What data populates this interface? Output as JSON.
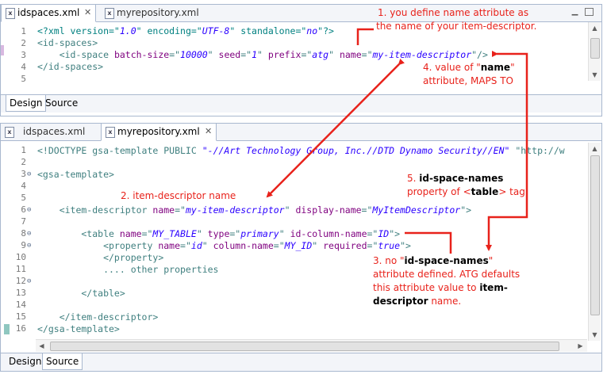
{
  "top_editor": {
    "tabs": [
      {
        "label": "idspaces.xml",
        "icon": "xml-file-icon",
        "active": true,
        "close": "✕"
      },
      {
        "label": "myrepository.xml",
        "icon": "xml-file-icon",
        "active": false
      }
    ],
    "line_numbers": [
      "1",
      "2",
      "3",
      "4",
      "5"
    ],
    "lines": [
      [
        [
          "pi",
          "<?xml version=\""
        ],
        [
          "av",
          "1.0"
        ],
        [
          "pi",
          "\" encoding=\""
        ],
        [
          "av",
          "UTF-8"
        ],
        [
          "pi",
          "\" standalone=\""
        ],
        [
          "av",
          "no"
        ],
        [
          "pi",
          "\"?>"
        ]
      ],
      [
        [
          "tg",
          "<id-spaces>"
        ]
      ],
      [
        [
          "tg",
          "    <id-space "
        ],
        [
          "an",
          "batch-size"
        ],
        [
          "tg",
          "=\""
        ],
        [
          "av",
          "10000"
        ],
        [
          "tg",
          "\" "
        ],
        [
          "an",
          "seed"
        ],
        [
          "tg",
          "=\""
        ],
        [
          "av",
          "1"
        ],
        [
          "tg",
          "\" "
        ],
        [
          "an",
          "prefix"
        ],
        [
          "tg",
          "=\""
        ],
        [
          "av",
          "atg"
        ],
        [
          "tg",
          "\" "
        ],
        [
          "an",
          "name"
        ],
        [
          "tg",
          "=\""
        ],
        [
          "av",
          "my-item-descriptor"
        ],
        [
          "tg",
          "\"/>"
        ]
      ],
      [
        [
          "tg",
          "</id-spaces>"
        ]
      ],
      [
        [
          "tg",
          ""
        ]
      ]
    ],
    "bottom_tabs": [
      "Design",
      "Source"
    ],
    "active_bottom_tab": "Design"
  },
  "bottom_editor": {
    "tabs": [
      {
        "label": "idspaces.xml",
        "icon": "xml-file-icon",
        "active": false
      },
      {
        "label": "myrepository.xml",
        "icon": "xml-file-icon",
        "active": true,
        "close": "✕"
      }
    ],
    "line_numbers": [
      "1",
      "2",
      "3",
      "4",
      "5",
      "6",
      "7",
      "8",
      "9",
      "10",
      "11",
      "12",
      "13",
      "14",
      "15",
      "16"
    ],
    "fold_markers": [
      "",
      "",
      "⊖",
      "",
      "",
      "⊖",
      "",
      "⊖",
      "⊖",
      "",
      "",
      "⊖",
      "",
      "",
      "",
      ""
    ],
    "lines": [
      [
        [
          "tg",
          "<!DOCTYPE gsa-template PUBLIC "
        ],
        [
          "av",
          "\"-//Art Technology Group, Inc.//DTD Dynamo Security//EN\""
        ],
        [
          "tg",
          " \"http://w"
        ]
      ],
      [
        [
          "tg",
          ""
        ]
      ],
      [
        [
          "tg",
          "<gsa-template>"
        ]
      ],
      [
        [
          "tg",
          ""
        ]
      ],
      [
        [
          "tg",
          ""
        ]
      ],
      [
        [
          "tg",
          "    <item-descriptor "
        ],
        [
          "an",
          "name"
        ],
        [
          "tg",
          "=\""
        ],
        [
          "av",
          "my-item-descriptor"
        ],
        [
          "tg",
          "\" "
        ],
        [
          "an",
          "display-name"
        ],
        [
          "tg",
          "=\""
        ],
        [
          "av",
          "MyItemDescriptor"
        ],
        [
          "tg",
          "\">"
        ]
      ],
      [
        [
          "tg",
          ""
        ]
      ],
      [
        [
          "tg",
          "        <table "
        ],
        [
          "an",
          "name"
        ],
        [
          "tg",
          "=\""
        ],
        [
          "av",
          "MY_TABLE"
        ],
        [
          "tg",
          "\" "
        ],
        [
          "an",
          "type"
        ],
        [
          "tg",
          "=\""
        ],
        [
          "av",
          "primary"
        ],
        [
          "tg",
          "\" "
        ],
        [
          "an",
          "id-column-name"
        ],
        [
          "tg",
          "=\""
        ],
        [
          "av",
          "ID"
        ],
        [
          "tg",
          "\">"
        ]
      ],
      [
        [
          "tg",
          "            <property "
        ],
        [
          "an",
          "name"
        ],
        [
          "tg",
          "=\""
        ],
        [
          "av",
          "id"
        ],
        [
          "tg",
          "\" "
        ],
        [
          "an",
          "column-name"
        ],
        [
          "tg",
          "=\""
        ],
        [
          "av",
          "MY_ID"
        ],
        [
          "tg",
          "\" "
        ],
        [
          "an",
          "required"
        ],
        [
          "tg",
          "=\""
        ],
        [
          "av",
          "true"
        ],
        [
          "tg",
          "\">"
        ]
      ],
      [
        [
          "tg",
          "            </property>"
        ]
      ],
      [
        [
          "tg",
          "            .... other properties"
        ]
      ],
      [
        [
          "tg",
          ""
        ]
      ],
      [
        [
          "tg",
          "        </table>"
        ]
      ],
      [
        [
          "tg",
          ""
        ]
      ],
      [
        [
          "tg",
          "    </item-descriptor>"
        ]
      ],
      [
        [
          "tg",
          "</gsa-template>"
        ]
      ]
    ],
    "bottom_tabs": [
      "Design",
      "Source"
    ],
    "active_bottom_tab": "Source"
  },
  "annotations": {
    "note1": {
      "l1": "1. you define name attribute as",
      "l2": "the name of your item-descriptor."
    },
    "note2": {
      "text": "2. item-descriptor name"
    },
    "note3": {
      "p1": "3. no \"",
      "b1": "id-space-names",
      "p2": "\"",
      "l2": "attribute defined. ATG defaults",
      "l3a": "this attribute value to ",
      "b3": "item-",
      "b4": "descriptor",
      "l4": " name."
    },
    "note4": {
      "p1": "4. value of \"",
      "b1": "name",
      "p2": "\"",
      "l2": "attribute, MAPS TO"
    },
    "note5": {
      "p1": "5. ",
      "b1": "id-space-names",
      "p2": "property of <",
      "b2": "table",
      "p3": "> tag."
    }
  },
  "colors": {
    "annotation": "#e8221b",
    "tag": "#3f7f7f",
    "attr_name": "#7f007f",
    "attr_value": "#2a00ff"
  }
}
